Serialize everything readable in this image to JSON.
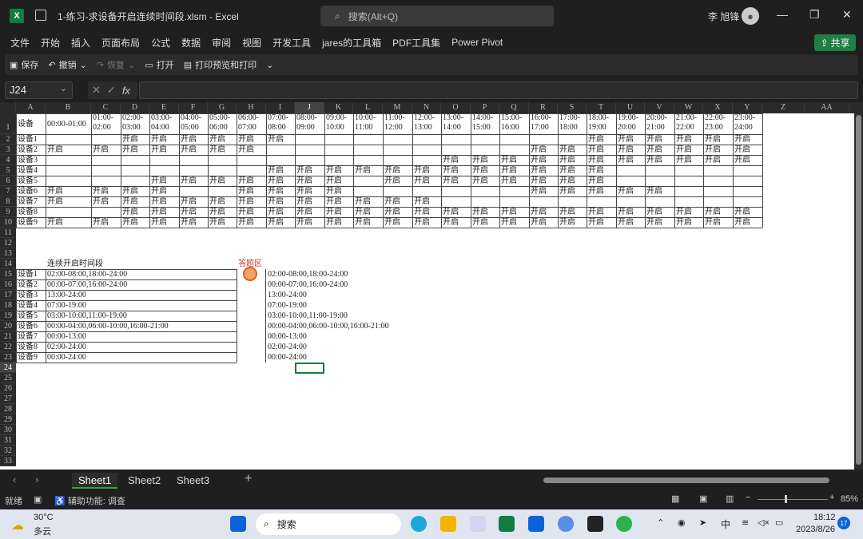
{
  "titlebar": {
    "app_icon": "X",
    "title": "1-练习-求设备开启连续时间段.xlsm  -  Excel",
    "search_placeholder": "搜索(Alt+Q)",
    "user": "李 旭锋"
  },
  "menu": [
    "文件",
    "开始",
    "插入",
    "页面布局",
    "公式",
    "数据",
    "审阅",
    "视图",
    "开发工具",
    "jares的工具箱",
    "PDF工具集",
    "Power Pivot"
  ],
  "share_label": "共享",
  "qat": {
    "save": "保存",
    "undo": "撤销",
    "redo": "恢复",
    "open": "打开",
    "print": "打印预览和打印"
  },
  "namebox": "J24",
  "fx_label": "fx",
  "columns": [
    "A",
    "B",
    "C",
    "D",
    "E",
    "F",
    "G",
    "H",
    "I",
    "J",
    "K",
    "L",
    "M",
    "N",
    "O",
    "P",
    "Q",
    "R",
    "S",
    "T",
    "U",
    "V",
    "W",
    "X",
    "Y",
    "Z",
    "AA"
  ],
  "rows": [
    "1",
    "2",
    "3",
    "4",
    "5",
    "6",
    "7",
    "8",
    "9",
    "10",
    "11",
    "12",
    "13",
    "14",
    "15",
    "16",
    "17",
    "18",
    "19",
    "20",
    "21",
    "22",
    "23",
    "24",
    "25",
    "26",
    "27",
    "28",
    "29",
    "30",
    "31",
    "32",
    "33"
  ],
  "header_row": {
    "a": "设备",
    "b": "00:00-01:00",
    "times": [
      "01:00-\n02:00",
      "02:00-\n03:00",
      "03:00-\n04:00",
      "04:00-\n05:00",
      "05:00-\n06:00",
      "06:00-\n07:00",
      "07:00-\n08:00",
      "08:00-\n09:00",
      "09:00-\n10:00",
      "10:00-\n11:00",
      "11:00-\n12:00",
      "12:00-\n13:00",
      "13:00-\n14:00",
      "14:00-\n15:00",
      "15:00-\n16:00",
      "16:00-\n17:00",
      "17:00-\n18:00",
      "18:00-\n19:00",
      "19:00-\n20:00",
      "20:00-\n21:00",
      "21:00-\n22:00",
      "22:00-\n23:00",
      "23:00-\n24:00"
    ]
  },
  "on_text": "开启",
  "devices": [
    {
      "name": "设备1",
      "on": [
        2,
        3,
        4,
        5,
        6,
        7,
        18,
        19,
        20,
        21,
        22,
        23
      ]
    },
    {
      "name": "设备2",
      "on": [
        0,
        1,
        2,
        3,
        4,
        5,
        6,
        16,
        17,
        18,
        19,
        20,
        21,
        22,
        23
      ]
    },
    {
      "name": "设备3",
      "on": [
        13,
        14,
        15,
        16,
        17,
        18,
        19,
        20,
        21,
        22,
        23
      ]
    },
    {
      "name": "设备4",
      "on": [
        7,
        8,
        9,
        10,
        11,
        12,
        13,
        14,
        15,
        16,
        17,
        18
      ]
    },
    {
      "name": "设备5",
      "on": [
        3,
        4,
        5,
        6,
        7,
        8,
        9,
        11,
        12,
        13,
        14,
        15,
        16,
        17,
        18
      ]
    },
    {
      "name": "设备6",
      "on": [
        0,
        1,
        2,
        3,
        6,
        7,
        8,
        9,
        16,
        17,
        18,
        19,
        20
      ]
    },
    {
      "name": "设备7",
      "on": [
        0,
        1,
        2,
        3,
        4,
        5,
        6,
        7,
        8,
        9,
        10,
        11,
        12
      ]
    },
    {
      "name": "设备8",
      "on": [
        2,
        3,
        4,
        5,
        6,
        7,
        8,
        9,
        10,
        11,
        12,
        13,
        14,
        15,
        16,
        17,
        18,
        19,
        20,
        21,
        22,
        23
      ]
    },
    {
      "name": "设备9",
      "on": [
        0,
        1,
        2,
        3,
        4,
        5,
        6,
        7,
        8,
        9,
        10,
        11,
        12,
        13,
        14,
        15,
        16,
        17,
        18,
        19,
        20,
        21,
        22,
        23
      ]
    }
  ],
  "summary": {
    "title": "连续开启时间段",
    "rows": [
      [
        "设备1",
        "02:00-08:00,18:00-24:00"
      ],
      [
        "设备2",
        "00:00-07:00,16:00-24:00"
      ],
      [
        "设备3",
        "13:00-24:00"
      ],
      [
        "设备4",
        "07:00-19:00"
      ],
      [
        "设备5",
        "03:00-10:00,11:00-19:00"
      ],
      [
        "设备6",
        "00:00-04:00,06:00-10:00,16:00-21:00"
      ],
      [
        "设备7",
        "00:00-13:00"
      ],
      [
        "设备8",
        "02:00-24:00"
      ],
      [
        "设备9",
        "00:00-24:00"
      ]
    ]
  },
  "answer": {
    "title": "答题区",
    "rows": [
      "02:00-08:00,18:00-24:00",
      "00:00-07:00,16:00-24:00",
      "13:00-24:00",
      "07:00-19:00",
      "03:00-10:00,11:00-19:00",
      "00:00-04:00,06:00-10:00,16:00-21:00",
      "00:00-13:00",
      "02:00-24:00",
      "00:00-24:00"
    ]
  },
  "sheets": [
    "Sheet1",
    "Sheet2",
    "Sheet3"
  ],
  "status": {
    "ready": "就绪",
    "accessibility": "辅助功能: 调查",
    "zoom": "85%"
  },
  "taskbar": {
    "temp": "30°C",
    "weather": "多云",
    "search": "搜索",
    "ime": "中",
    "time": "18:12",
    "date": "2023/8/26",
    "badge": "17"
  }
}
